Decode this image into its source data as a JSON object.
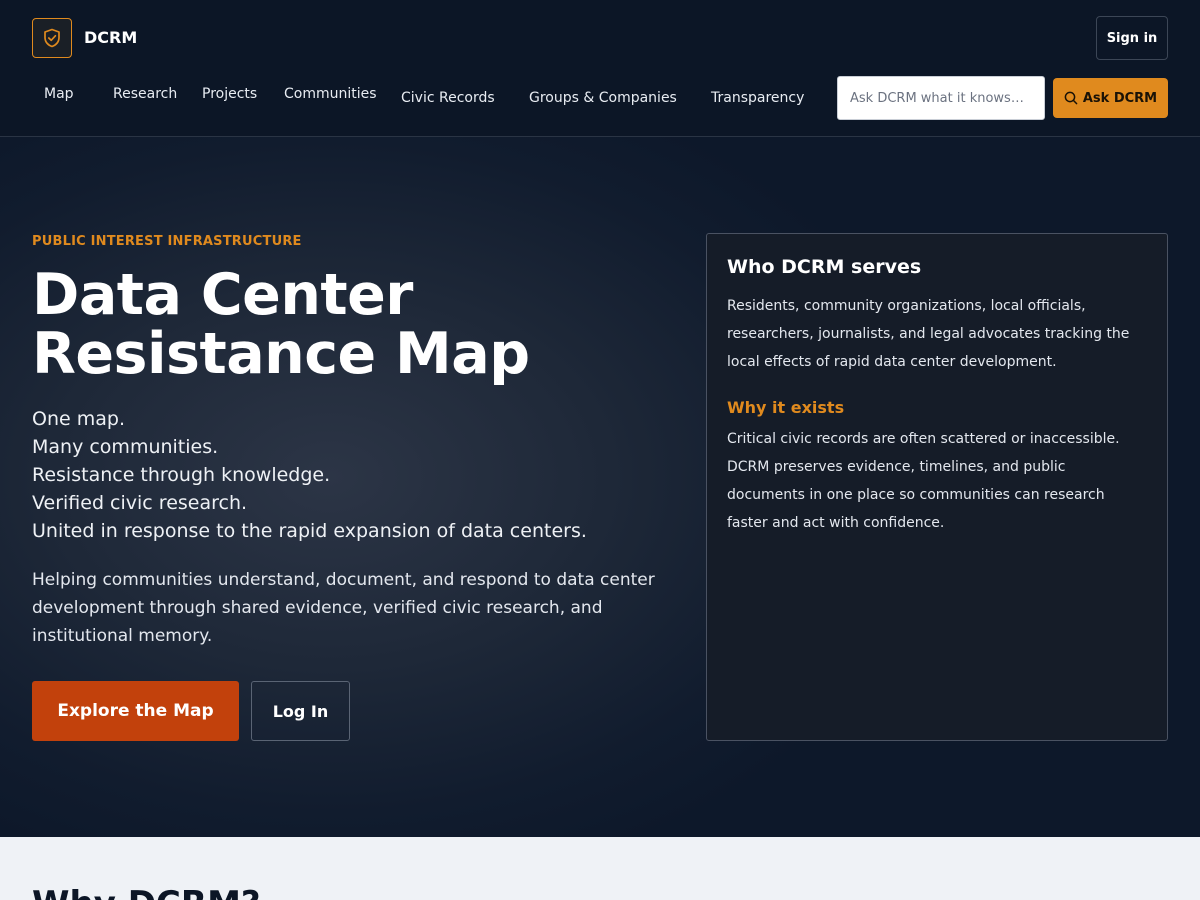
{
  "header": {
    "brand": "DCRM",
    "sign_in": "Sign in",
    "nav": [
      "Map",
      "Research",
      "Projects",
      "Communities",
      "Civic Records",
      "Groups & Companies",
      "Transparency"
    ],
    "search_placeholder": "Ask DCRM what it knows…",
    "ask_button": "Ask DCRM"
  },
  "hero": {
    "eyebrow": "PUBLIC INTEREST INFRASTRUCTURE",
    "title": "Data Center Resistance Map",
    "taglines": [
      "One map.",
      "Many communities.",
      "Resistance through knowledge.",
      "Verified civic research.",
      "United in response to the rapid expansion of data centers."
    ],
    "intro": "Helping communities understand, document, and respond to data center development through shared evidence, verified civic research, and institutional memory.",
    "explore_button": "Explore the Map",
    "login_button": "Log In"
  },
  "panel": {
    "heading": "Who DCRM serves",
    "body": "Residents, community organizations, local officials, researchers, journalists, and legal advocates tracking the local effects of rapid data center development.",
    "subheading": "Why it exists",
    "subbody": "Critical civic records are often scattered or inaccessible. DCRM preserves evidence, timelines, and public documents in one place so communities can research faster and act with confidence."
  },
  "lower": {
    "title": "Why DCRM?"
  },
  "colors": {
    "accent": "#e08a1e",
    "primary_button": "#c2410c",
    "background": "#0c1626"
  }
}
